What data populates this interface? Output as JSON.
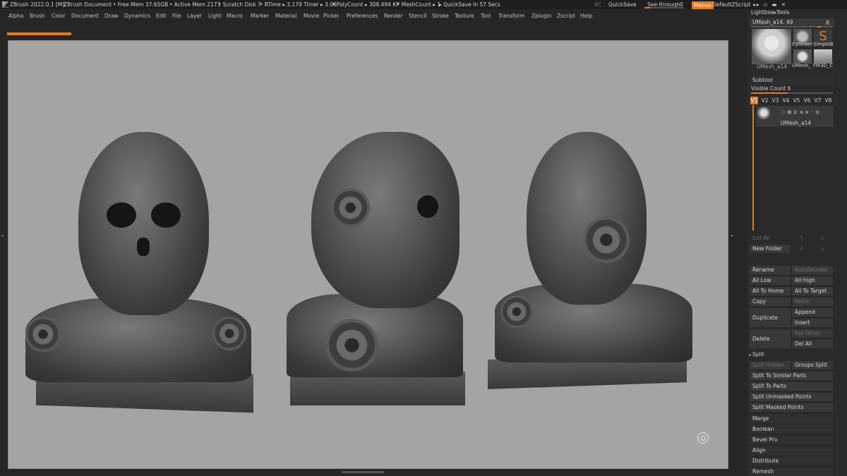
{
  "titlebar": {
    "app": "ZBrush 2022.0.1 [M]",
    "document": "ZBrush Document",
    "free_mem": "• Free Mem 37.65GB",
    "active_mem": "• Active Mem 2173",
    "scratch_disk": "• Scratch Disk 7",
    "rtime": "• RTime ▸ 3.179 Timer ▸ 3.08",
    "polycount": "• PolyCount ▸ 308.494 KP",
    "meshcount": "• MeshCount ▸ 1",
    "quicksave_in": "▸ QuickSave In 57 Secs",
    "ac": "AC",
    "quicksave": "QuickSave",
    "see_through_label": "See-through",
    "see_through_value": "0",
    "menus": "Menus",
    "default_zscript": "DefaultZScript",
    "see_through_level": 0
  },
  "menubar": [
    "Alpha",
    "Brush",
    "Color",
    "Document",
    "Draw",
    "Dynamics",
    "Edit",
    "File",
    "Layer",
    "Light",
    "Macro",
    "Marker",
    "Material",
    "Movie",
    "Picker",
    "Preferences",
    "Render",
    "Stencil",
    "Stroke",
    "Texture",
    "Tool",
    "Transform",
    "Zplugin",
    "Zscript",
    "Help"
  ],
  "rightpanel": {
    "lightbox_tools": "Lightbox▸Tools",
    "tool_name": "UMesh_a14. 49",
    "tool_r": "R",
    "thumb_main_label": "UMesh_a14",
    "thumb_cylinder": "Cylinder",
    "thumb_simpleb": "SimpleB",
    "thumb_umesh": "UMesh_",
    "thumb_fm3d": "FM3D_C",
    "subtool_title": "Subtool",
    "visible_count": "Visible Count 6",
    "visible_count_level": 0.45,
    "v_buttons": [
      "V1",
      "V2",
      "V3",
      "V4",
      "V5",
      "V6",
      "V7",
      "V8"
    ],
    "v_active": "V1",
    "subtool_item": "UMesh_a14",
    "list_all": "List All",
    "new_folder": "New Folder",
    "rename": "Rename",
    "auto_reorder": "AutoReorder",
    "all_low": "All Low",
    "all_high": "All High",
    "all_to_home": "All To Home",
    "all_to_target": "All To Target",
    "copy": "Copy",
    "paste": "Paste",
    "duplicate": "Duplicate",
    "append": "Append",
    "insert": "Insert",
    "delete": "Delete",
    "del_other": "Del Other",
    "del_all": "Del All",
    "split": "Split",
    "split_hidden": "Split Hidden",
    "groups_split": "Groups Split",
    "split_similar": "Split To Similar Parts",
    "split_parts": "Split To Parts",
    "split_unmasked": "Split Unmasked Points",
    "split_masked": "Split Masked Points",
    "merge": "Merge",
    "boolean": "Boolean",
    "bevel_pro": "Bevel Pro",
    "align": "Align",
    "distribute": "Distribute",
    "remesh": "Remesh"
  },
  "colors": {
    "accent": "#e07b20",
    "viewport_bg": "#a4a4a4",
    "panel_bg": "#2a2a2a"
  }
}
